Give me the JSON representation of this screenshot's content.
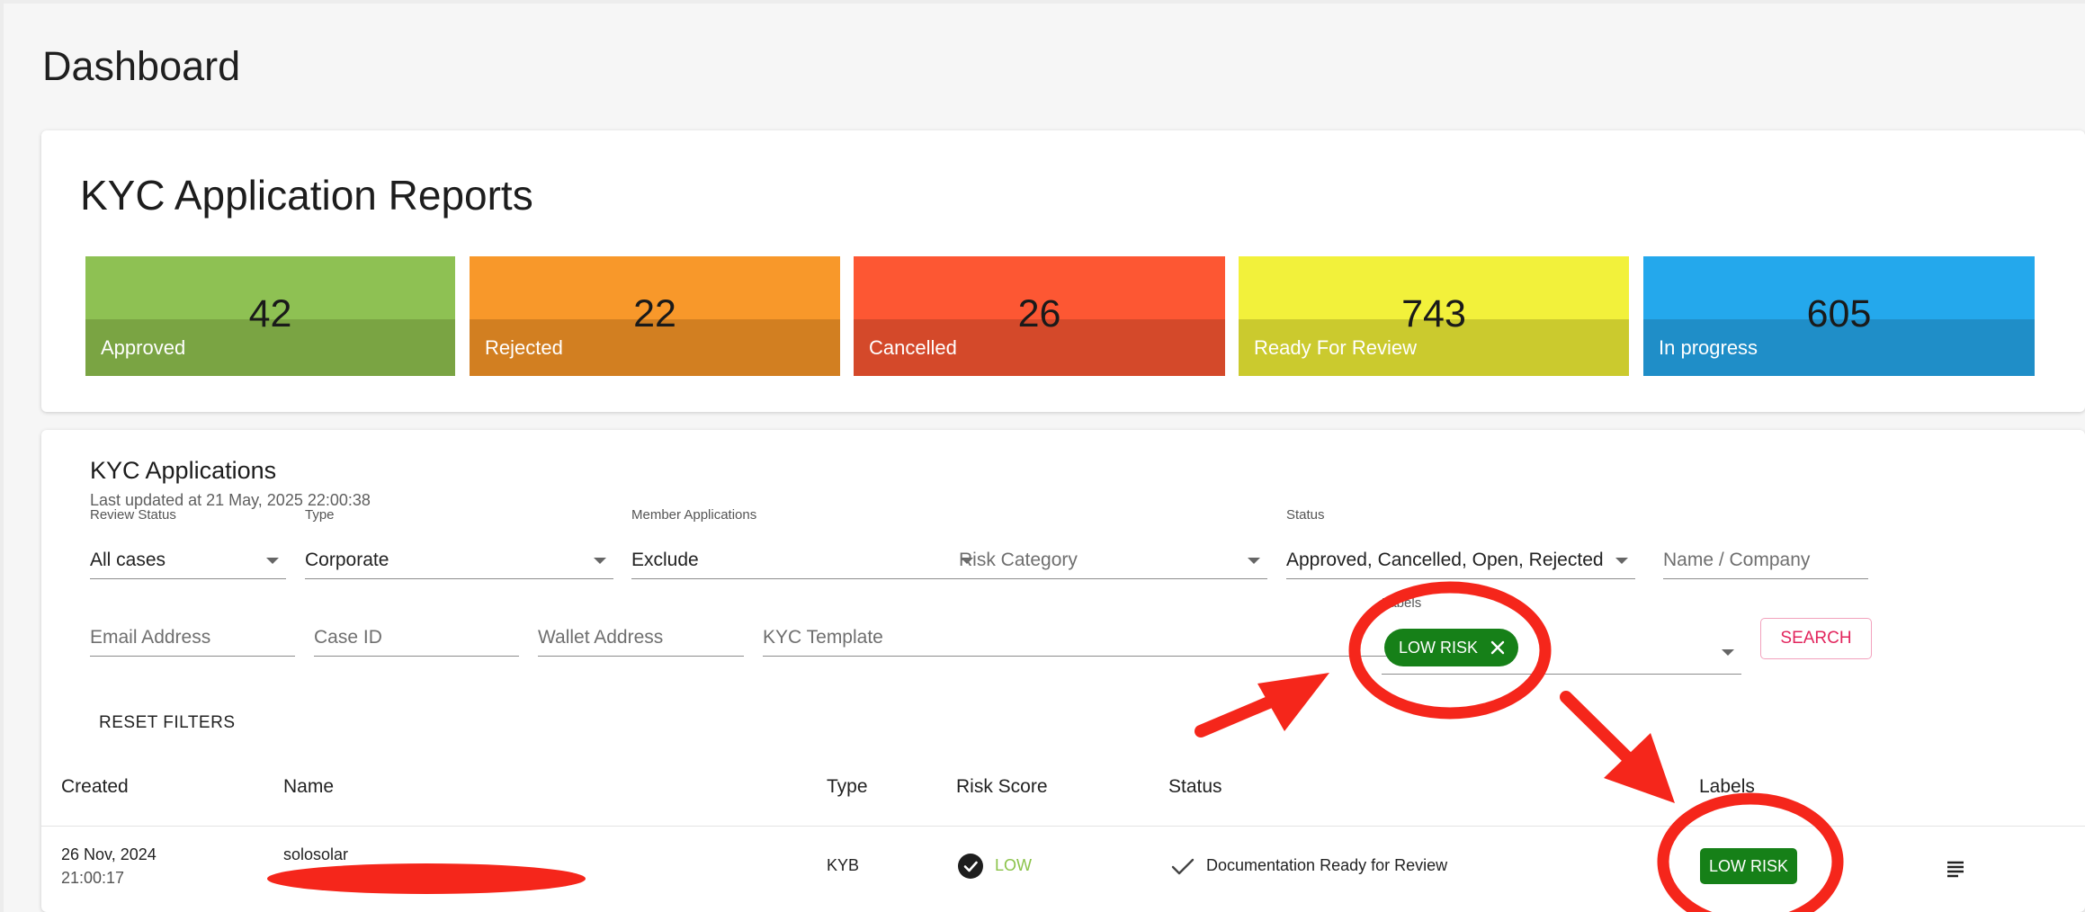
{
  "page": {
    "title": "Dashboard"
  },
  "reports": {
    "title": "KYC Application Reports",
    "stats": [
      {
        "value": "42",
        "label": "Approved",
        "top_color": "#8ec153",
        "bottom_color": "#7aa443"
      },
      {
        "value": "22",
        "label": "Rejected",
        "top_color": "#f8982a",
        "bottom_color": "#d27f21"
      },
      {
        "value": "26",
        "label": "Cancelled",
        "top_color": "#fd5733",
        "bottom_color": "#d4492a"
      },
      {
        "value": "743",
        "label": "Ready For Review",
        "top_color": "#f2f13b",
        "bottom_color": "#cbca2e"
      },
      {
        "value": "605",
        "label": "In progress",
        "top_color": "#24a8ec",
        "bottom_color": "#1f8ec8"
      }
    ]
  },
  "applications": {
    "title": "KYC Applications",
    "last_updated": "Last updated at 21 May, 2025 22:00:38",
    "filters": {
      "review_status": {
        "label": "Review Status",
        "value": "All cases"
      },
      "type": {
        "label": "Type",
        "value": "Corporate"
      },
      "member_applications": {
        "label": "Member Applications",
        "value": "Exclude"
      },
      "risk_category": {
        "placeholder": "Risk Category"
      },
      "status": {
        "label": "Status",
        "value": "Approved, Cancelled, Open, Rejected"
      },
      "name_company": {
        "placeholder": "Name / Company"
      },
      "email": {
        "placeholder": "Email Address"
      },
      "case_id": {
        "placeholder": "Case ID"
      },
      "wallet": {
        "placeholder": "Wallet Address"
      },
      "kyc_template": {
        "placeholder": "KYC Template"
      },
      "labels": {
        "label": "Labels",
        "chip": "LOW RISK"
      }
    },
    "search_label": "SEARCH",
    "reset_label": "RESET FILTERS",
    "columns": [
      "Created",
      "Name",
      "Type",
      "Risk Score",
      "Status",
      "Labels"
    ],
    "rows": [
      {
        "created_date": "26 Nov, 2024",
        "created_time": "21:00:17",
        "name": "solosolar",
        "type": "KYB",
        "risk": "LOW",
        "status": "Documentation Ready for Review",
        "label": "LOW RISK"
      }
    ]
  },
  "colors": {
    "accent_pink": "#e2255d",
    "label_green": "#168018",
    "risk_low": "#8bc34a",
    "annotation_red": "#f5261b"
  },
  "icons": [
    "close-icon",
    "dropdown-caret-icon",
    "check-circle-icon",
    "check-icon",
    "details-menu-icon"
  ]
}
